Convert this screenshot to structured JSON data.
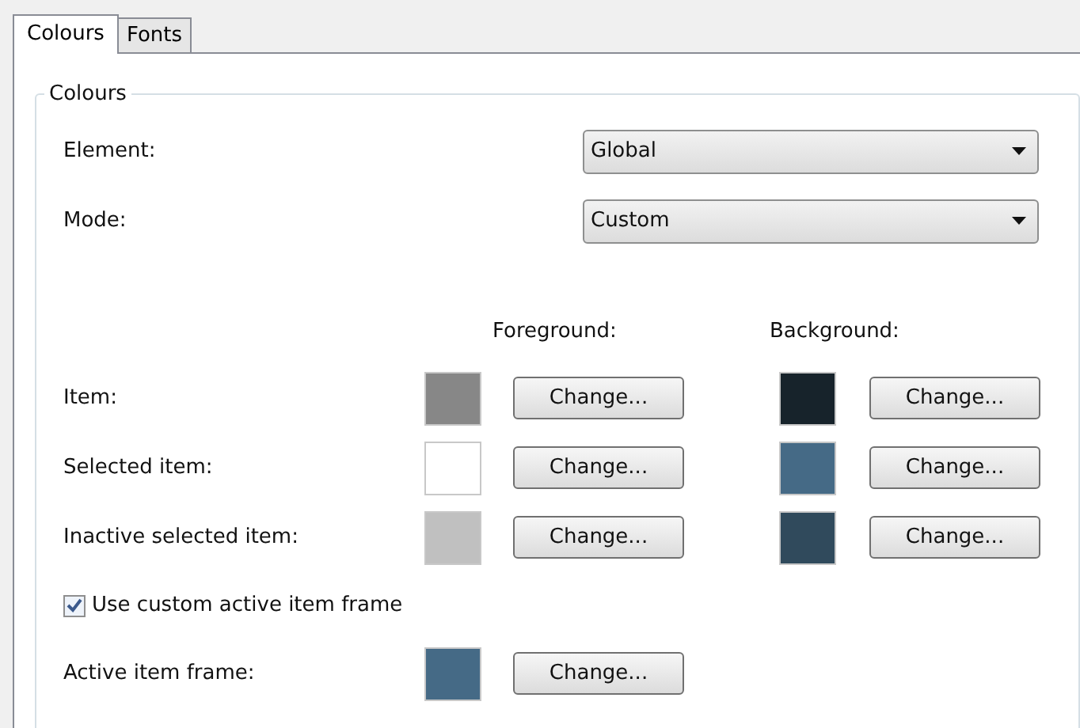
{
  "tabs": [
    {
      "label": "Colours",
      "selected": true
    },
    {
      "label": "Fonts",
      "selected": false
    }
  ],
  "group": {
    "title": "Colours",
    "fields": [
      {
        "label": "Element:",
        "value": "Global"
      },
      {
        "label": "Mode:",
        "value": "Custom"
      }
    ],
    "headers": [
      "Foreground:",
      "Background:"
    ],
    "rows": [
      {
        "label": "Item:",
        "foreground": {
          "color": "#878787",
          "button": "Change..."
        },
        "background": {
          "color": "#17232b",
          "button": "Change..."
        }
      },
      {
        "label": "Selected item:",
        "foreground": {
          "color": "#ffffff",
          "button": "Change..."
        },
        "background": {
          "color": "#456a86",
          "button": "Change..."
        }
      },
      {
        "label": "Inactive selected item:",
        "foreground": {
          "color": "#c0c0c0",
          "button": "Change..."
        },
        "background": {
          "color": "#304a5c",
          "button": "Change..."
        }
      }
    ],
    "checkbox": {
      "label": "Use custom active item frame",
      "checked": true
    },
    "frame": {
      "label": "Active item frame:",
      "foreground": {
        "color": "#456a86",
        "button": "Change..."
      }
    }
  }
}
